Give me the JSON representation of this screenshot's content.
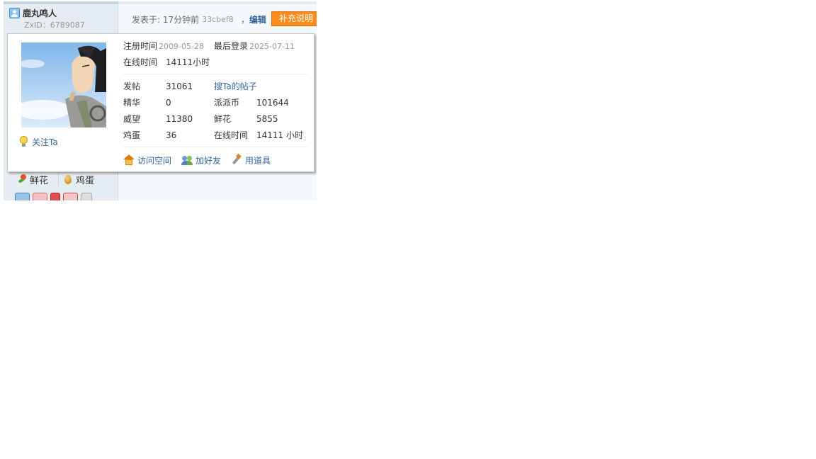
{
  "author": {
    "name": "鹿丸鸣人",
    "zxid": "ZxID：6789087"
  },
  "post_header": {
    "posted_label": "发表于: 17分钟前",
    "hash": "33cbef8",
    "comma": "，",
    "edit_label": "编辑",
    "supplement_label": "补充说明"
  },
  "popup": {
    "follow_label": "关注Ta",
    "register_label": "注册时间",
    "register_date": "2009-05-28",
    "last_login_label": "最后登录",
    "last_login_date": "2025-07-11",
    "online_label": "在线时间",
    "online_value": "14111小时",
    "stats": {
      "posts_label": "发帖",
      "posts_value": "31061",
      "search_posts_link": "搜Ta的帖子",
      "digest_label": "精华",
      "digest_value": "0",
      "coins_label": "派派币",
      "coins_value": "101644",
      "prestige_label": "威望",
      "prestige_value": "11380",
      "flowers_label": "鲜花",
      "flowers_value": "5855",
      "eggs_label": "鸡蛋",
      "eggs_value": "36",
      "online2_label": "在线时间",
      "online2_value": "14111 小时"
    },
    "actions": {
      "visit_space": "访问空间",
      "add_friend": "加好友",
      "use_item": "用道具"
    }
  },
  "sidebar_actions": {
    "flower_label": "鲜花",
    "egg_label": "鸡蛋"
  },
  "icons": [
    "user-icon",
    "bulb-icon",
    "home-icon",
    "add-friend-icon",
    "tool-icon",
    "flower-icon",
    "egg-icon"
  ],
  "colors": {
    "link": "#336699",
    "supplement_button": "#f98c1a",
    "sidebar_bg": "#e5edf2",
    "content_bg": "#f5f8fb"
  }
}
